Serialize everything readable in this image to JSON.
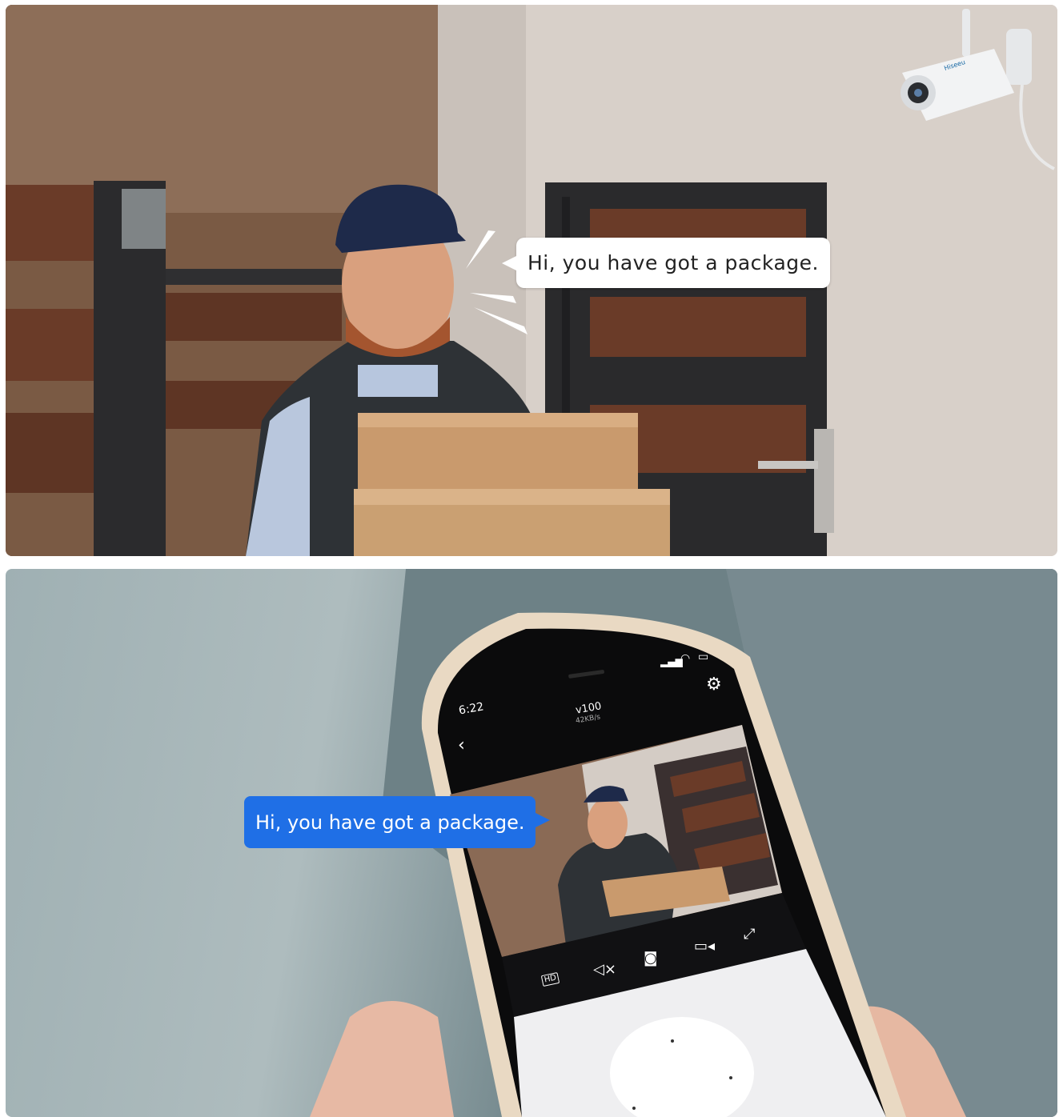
{
  "top_scene": {
    "speech": "Hi, you have got a package.",
    "camera_brand": "Hiseeu"
  },
  "phone": {
    "time": "6:22",
    "device_name": "v100",
    "speed": "42KB/s",
    "speech": "Hi, you have got a package.",
    "icons": {
      "back": "back-chevron-icon",
      "settings": "gear-icon",
      "hd": "hd-icon",
      "mute": "mute-icon",
      "snapshot": "camera-icon",
      "record": "video-record-icon",
      "fullscreen": "fullscreen-icon"
    }
  }
}
